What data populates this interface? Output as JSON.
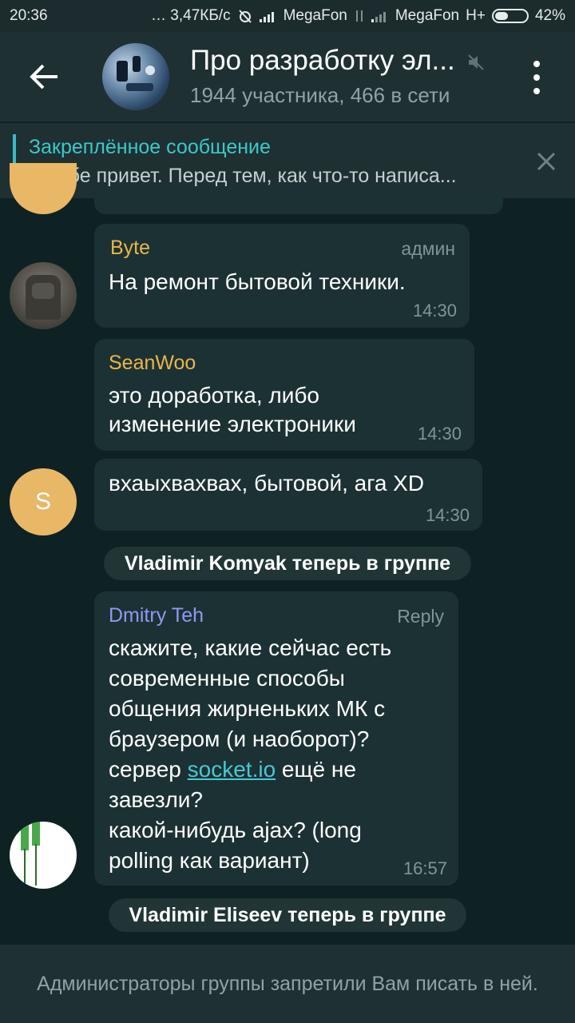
{
  "status": {
    "time": "20:36",
    "speed": "… 3,47КБ/с",
    "carrier1": "MegaFon",
    "carrier2": "MegaFon",
    "network": "H+",
    "battery": "42%",
    "battery_level": 0.42
  },
  "header": {
    "title": "Про разработку эл...",
    "subtitle": "1944 участника, 466 в сети",
    "icons": [
      "back-arrow-icon",
      "mute-icon",
      "more-vert-icon"
    ]
  },
  "pinned": {
    "title": "Закреплённое сообщение",
    "text": "И тебе привет. Перед тем, как что-то написа..."
  },
  "messages": [
    {
      "name": "Byte",
      "role": "админ",
      "text": "На ремонт бытовой техники.",
      "time": "14:30",
      "name_color": "#e8b64d"
    },
    {
      "name": "SeanWoo",
      "text_line1": "это доработка, либо",
      "text_line2": "изменение электроники",
      "time": "14:30",
      "name_color": "#e8b64d"
    },
    {
      "avatar_letter": "S",
      "text": "вхаыхвахвах, бытовой, ага XD",
      "time": "14:30"
    },
    {
      "name": "Dmitry Teh",
      "reply": "Reply",
      "lines": [
        "скажите, какие сейчас есть",
        "современные способы",
        "общения жирненьких МК с",
        "браузером (и наоборот)?"
      ],
      "line5_prefix": "сервер ",
      "link": "socket.io",
      "line5_suffix": " ещё не",
      "lines2": [
        "завезли?",
        "какой-нибудь ajax? (long",
        "polling как вариант)"
      ],
      "time": "16:57",
      "name_color": "#8e99f0"
    }
  ],
  "service": {
    "joined1": "Vladimir Komyak теперь в группе",
    "joined2": "Vladimir Eliseev теперь в группе"
  },
  "footer": {
    "notice": "Администраторы группы запретили Вам писать в ней."
  }
}
